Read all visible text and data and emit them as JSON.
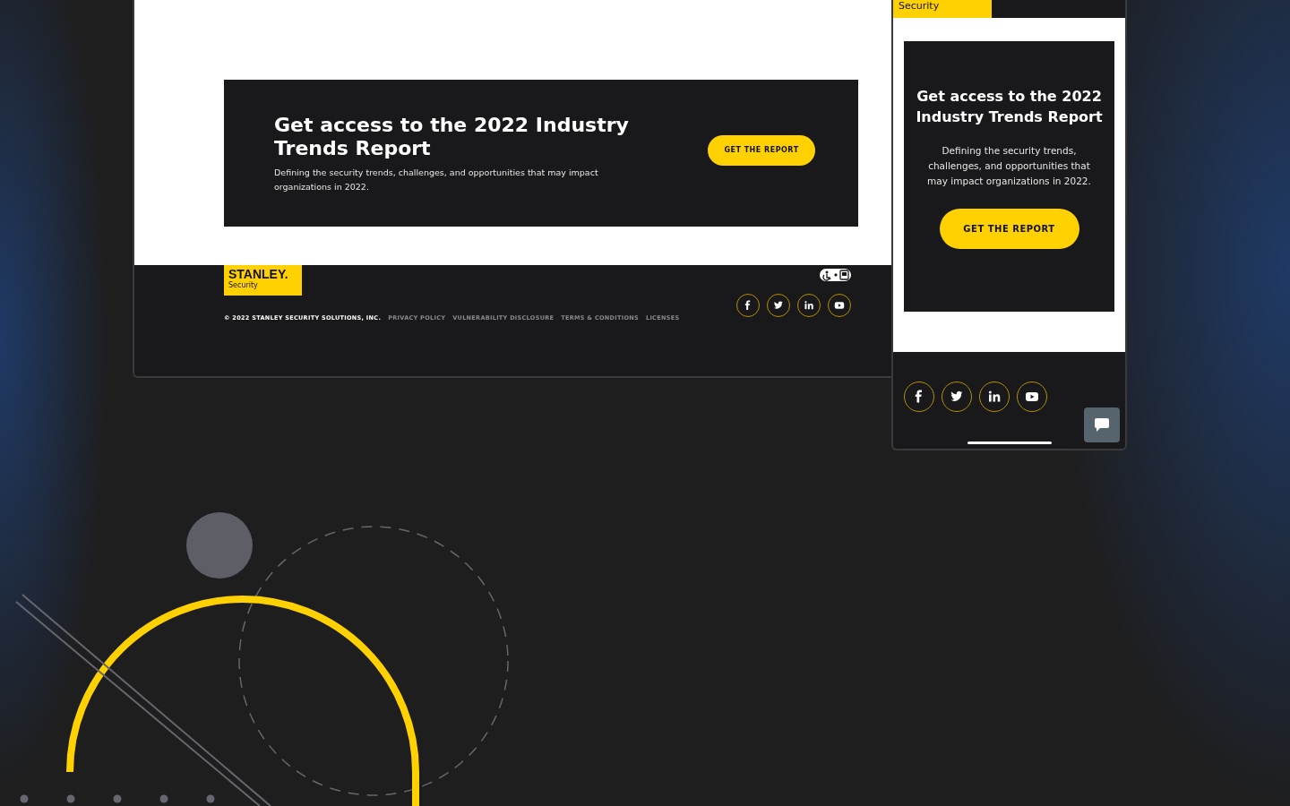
{
  "desktop": {
    "banner": {
      "title": "Get access to the 2022 Industry Trends Report",
      "description": "Defining the security trends, challenges, and opportunities that may impact organizations in 2022.",
      "button": "GET THE REPORT"
    },
    "footer": {
      "logo": {
        "name": "STANLEY.",
        "sub": "Security"
      },
      "copyright": "© 2022 STANLEY SECURITY SOLUTIONS, INC.",
      "links": [
        "PRIVACY POLICY",
        "VULNERABILITY DISCLOSURE",
        "TERMS & CONDITIONS",
        "LICENSES"
      ],
      "social": [
        {
          "kind": "facebook"
        },
        {
          "kind": "twitter"
        },
        {
          "kind": "linkedin"
        },
        {
          "kind": "youtube"
        }
      ]
    }
  },
  "mobile": {
    "header_tab": "Security",
    "banner": {
      "title": "Get access to the 2022 Industry Trends Report",
      "description": "Defining the security trends, challenges, and opportunities that may impact organizations in 2022.",
      "button": "GET THE REPORT"
    },
    "social": [
      {
        "kind": "facebook"
      },
      {
        "kind": "twitter"
      },
      {
        "kind": "linkedin"
      },
      {
        "kind": "youtube"
      }
    ]
  }
}
